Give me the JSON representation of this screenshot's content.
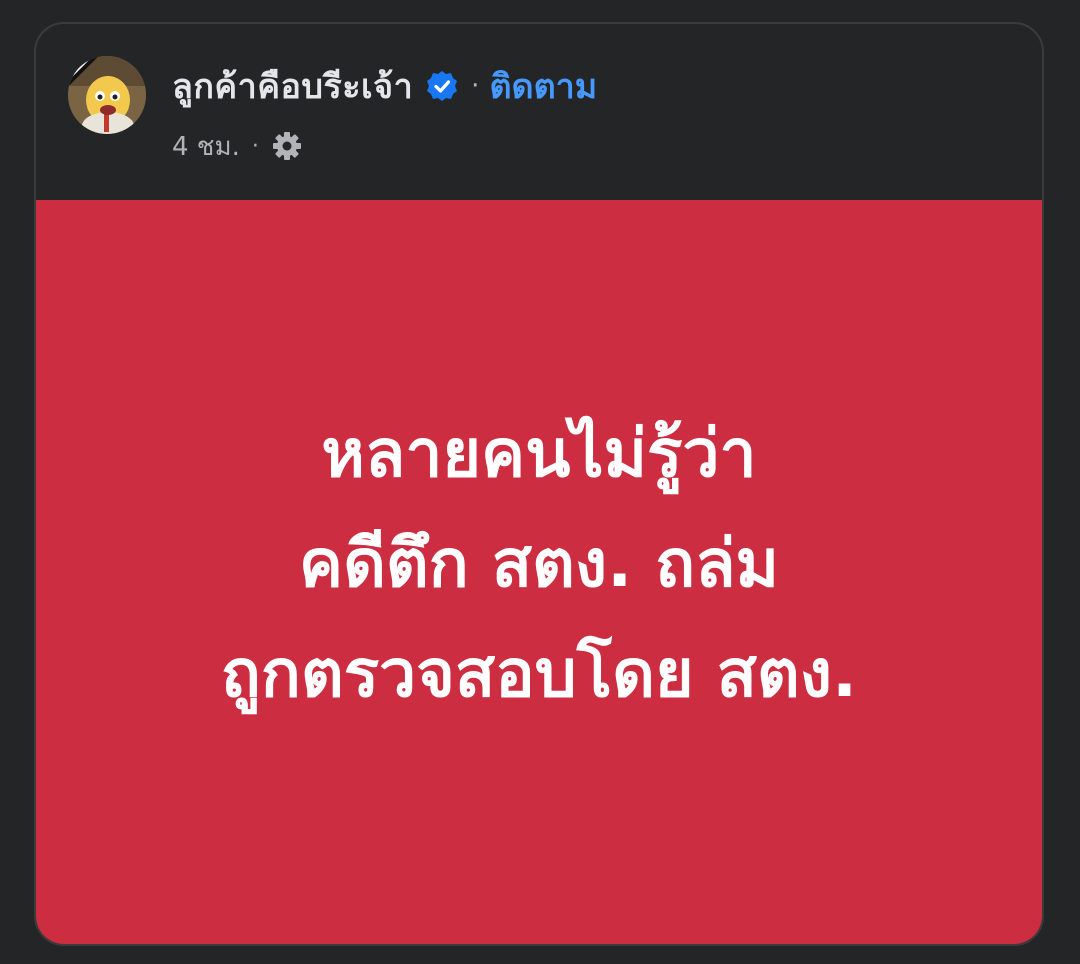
{
  "post": {
    "page_name": "ลูกค้าคือบรีะเจ้า",
    "follow_label": "ติดตาม",
    "separator": "·",
    "timestamp": "4 ชม.",
    "meta_separator": "·",
    "privacy_icon": "gear-icon",
    "verified_icon": "verified-badge-icon",
    "lines": [
      "หลายคนไม่รู้ว่า",
      "คดีตึก สตง. ถล่ม",
      "ถูกตรวจสอบโดย สตง."
    ]
  },
  "colors": {
    "background": "#242526",
    "post_background": "#cd2d41",
    "follow_link": "#4599ff",
    "verified_badge": "#1877f2",
    "name_text": "#e4e6eb",
    "meta_text": "#b0b3b8"
  }
}
